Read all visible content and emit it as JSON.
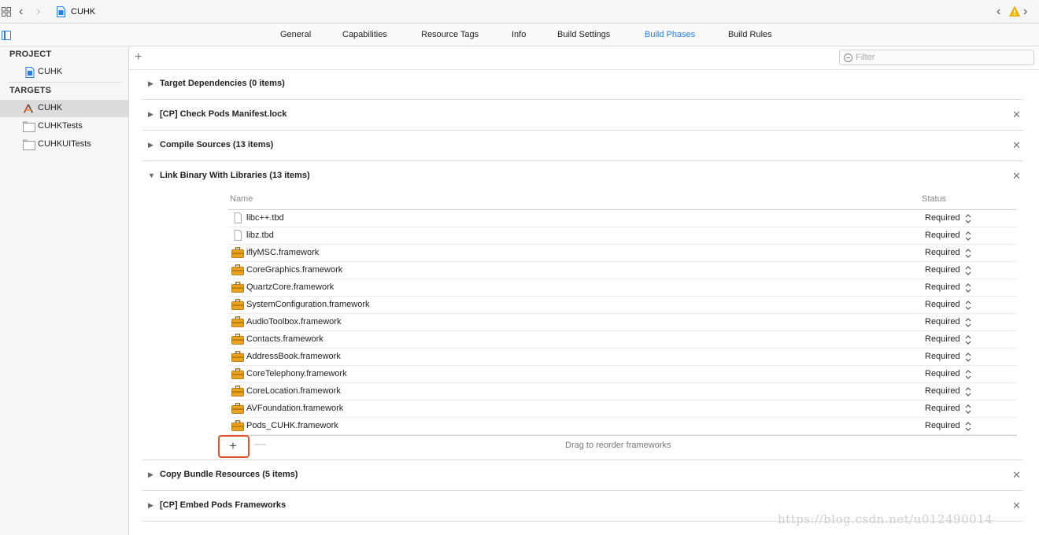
{
  "topbar": {
    "crumb": "CUHK"
  },
  "tabs": [
    {
      "label": "General",
      "active": false
    },
    {
      "label": "Capabilities",
      "active": false
    },
    {
      "label": "Resource Tags",
      "active": false
    },
    {
      "label": "Info",
      "active": false
    },
    {
      "label": "Build Settings",
      "active": false
    },
    {
      "label": "Build Phases",
      "active": true
    },
    {
      "label": "Build Rules",
      "active": false
    }
  ],
  "sidebar": {
    "project_header": "PROJECT",
    "project_item": "CUHK",
    "targets_header": "TARGETS",
    "targets": [
      {
        "label": "CUHK",
        "selected": true,
        "icon": "app-target-icon"
      },
      {
        "label": "CUHKTests",
        "selected": false,
        "icon": "folder-icon"
      },
      {
        "label": "CUHKUITests",
        "selected": false,
        "icon": "folder-icon"
      }
    ]
  },
  "filter": {
    "placeholder": "Filter"
  },
  "phases": {
    "target_dependencies": "Target Dependencies (0 items)",
    "check_pods_manifest": "[CP] Check Pods Manifest.lock",
    "compile_sources": "Compile Sources (13 items)",
    "link_binary": "Link Binary With Libraries (13 items)",
    "copy_bundle": "Copy Bundle Resources (5 items)",
    "embed_pods": "[CP] Embed Pods Frameworks"
  },
  "libraries": {
    "col_name": "Name",
    "col_status": "Status",
    "rows": [
      {
        "name": "libc++.tbd",
        "status": "Required",
        "icon": "file-icon"
      },
      {
        "name": "libz.tbd",
        "status": "Required",
        "icon": "file-icon"
      },
      {
        "name": "iflyMSC.framework",
        "status": "Required",
        "icon": "toolbox-icon"
      },
      {
        "name": "CoreGraphics.framework",
        "status": "Required",
        "icon": "toolbox-icon"
      },
      {
        "name": "QuartzCore.framework",
        "status": "Required",
        "icon": "toolbox-icon"
      },
      {
        "name": "SystemConfiguration.framework",
        "status": "Required",
        "icon": "toolbox-icon"
      },
      {
        "name": "AudioToolbox.framework",
        "status": "Required",
        "icon": "toolbox-icon"
      },
      {
        "name": "Contacts.framework",
        "status": "Required",
        "icon": "toolbox-icon"
      },
      {
        "name": "AddressBook.framework",
        "status": "Required",
        "icon": "toolbox-icon"
      },
      {
        "name": "CoreTelephony.framework",
        "status": "Required",
        "icon": "toolbox-icon"
      },
      {
        "name": "CoreLocation.framework",
        "status": "Required",
        "icon": "toolbox-icon"
      },
      {
        "name": "AVFoundation.framework",
        "status": "Required",
        "icon": "toolbox-icon"
      },
      {
        "name": "Pods_CUHK.framework",
        "status": "Required",
        "icon": "toolbox-icon"
      }
    ],
    "drag_hint": "Drag to reorder frameworks"
  },
  "watermark": "https://blog.csdn.net/u012490014",
  "colors": {
    "accent": "#2a7de1",
    "highlight_box": "#e0532c",
    "framework_icon": "#e9a321"
  }
}
